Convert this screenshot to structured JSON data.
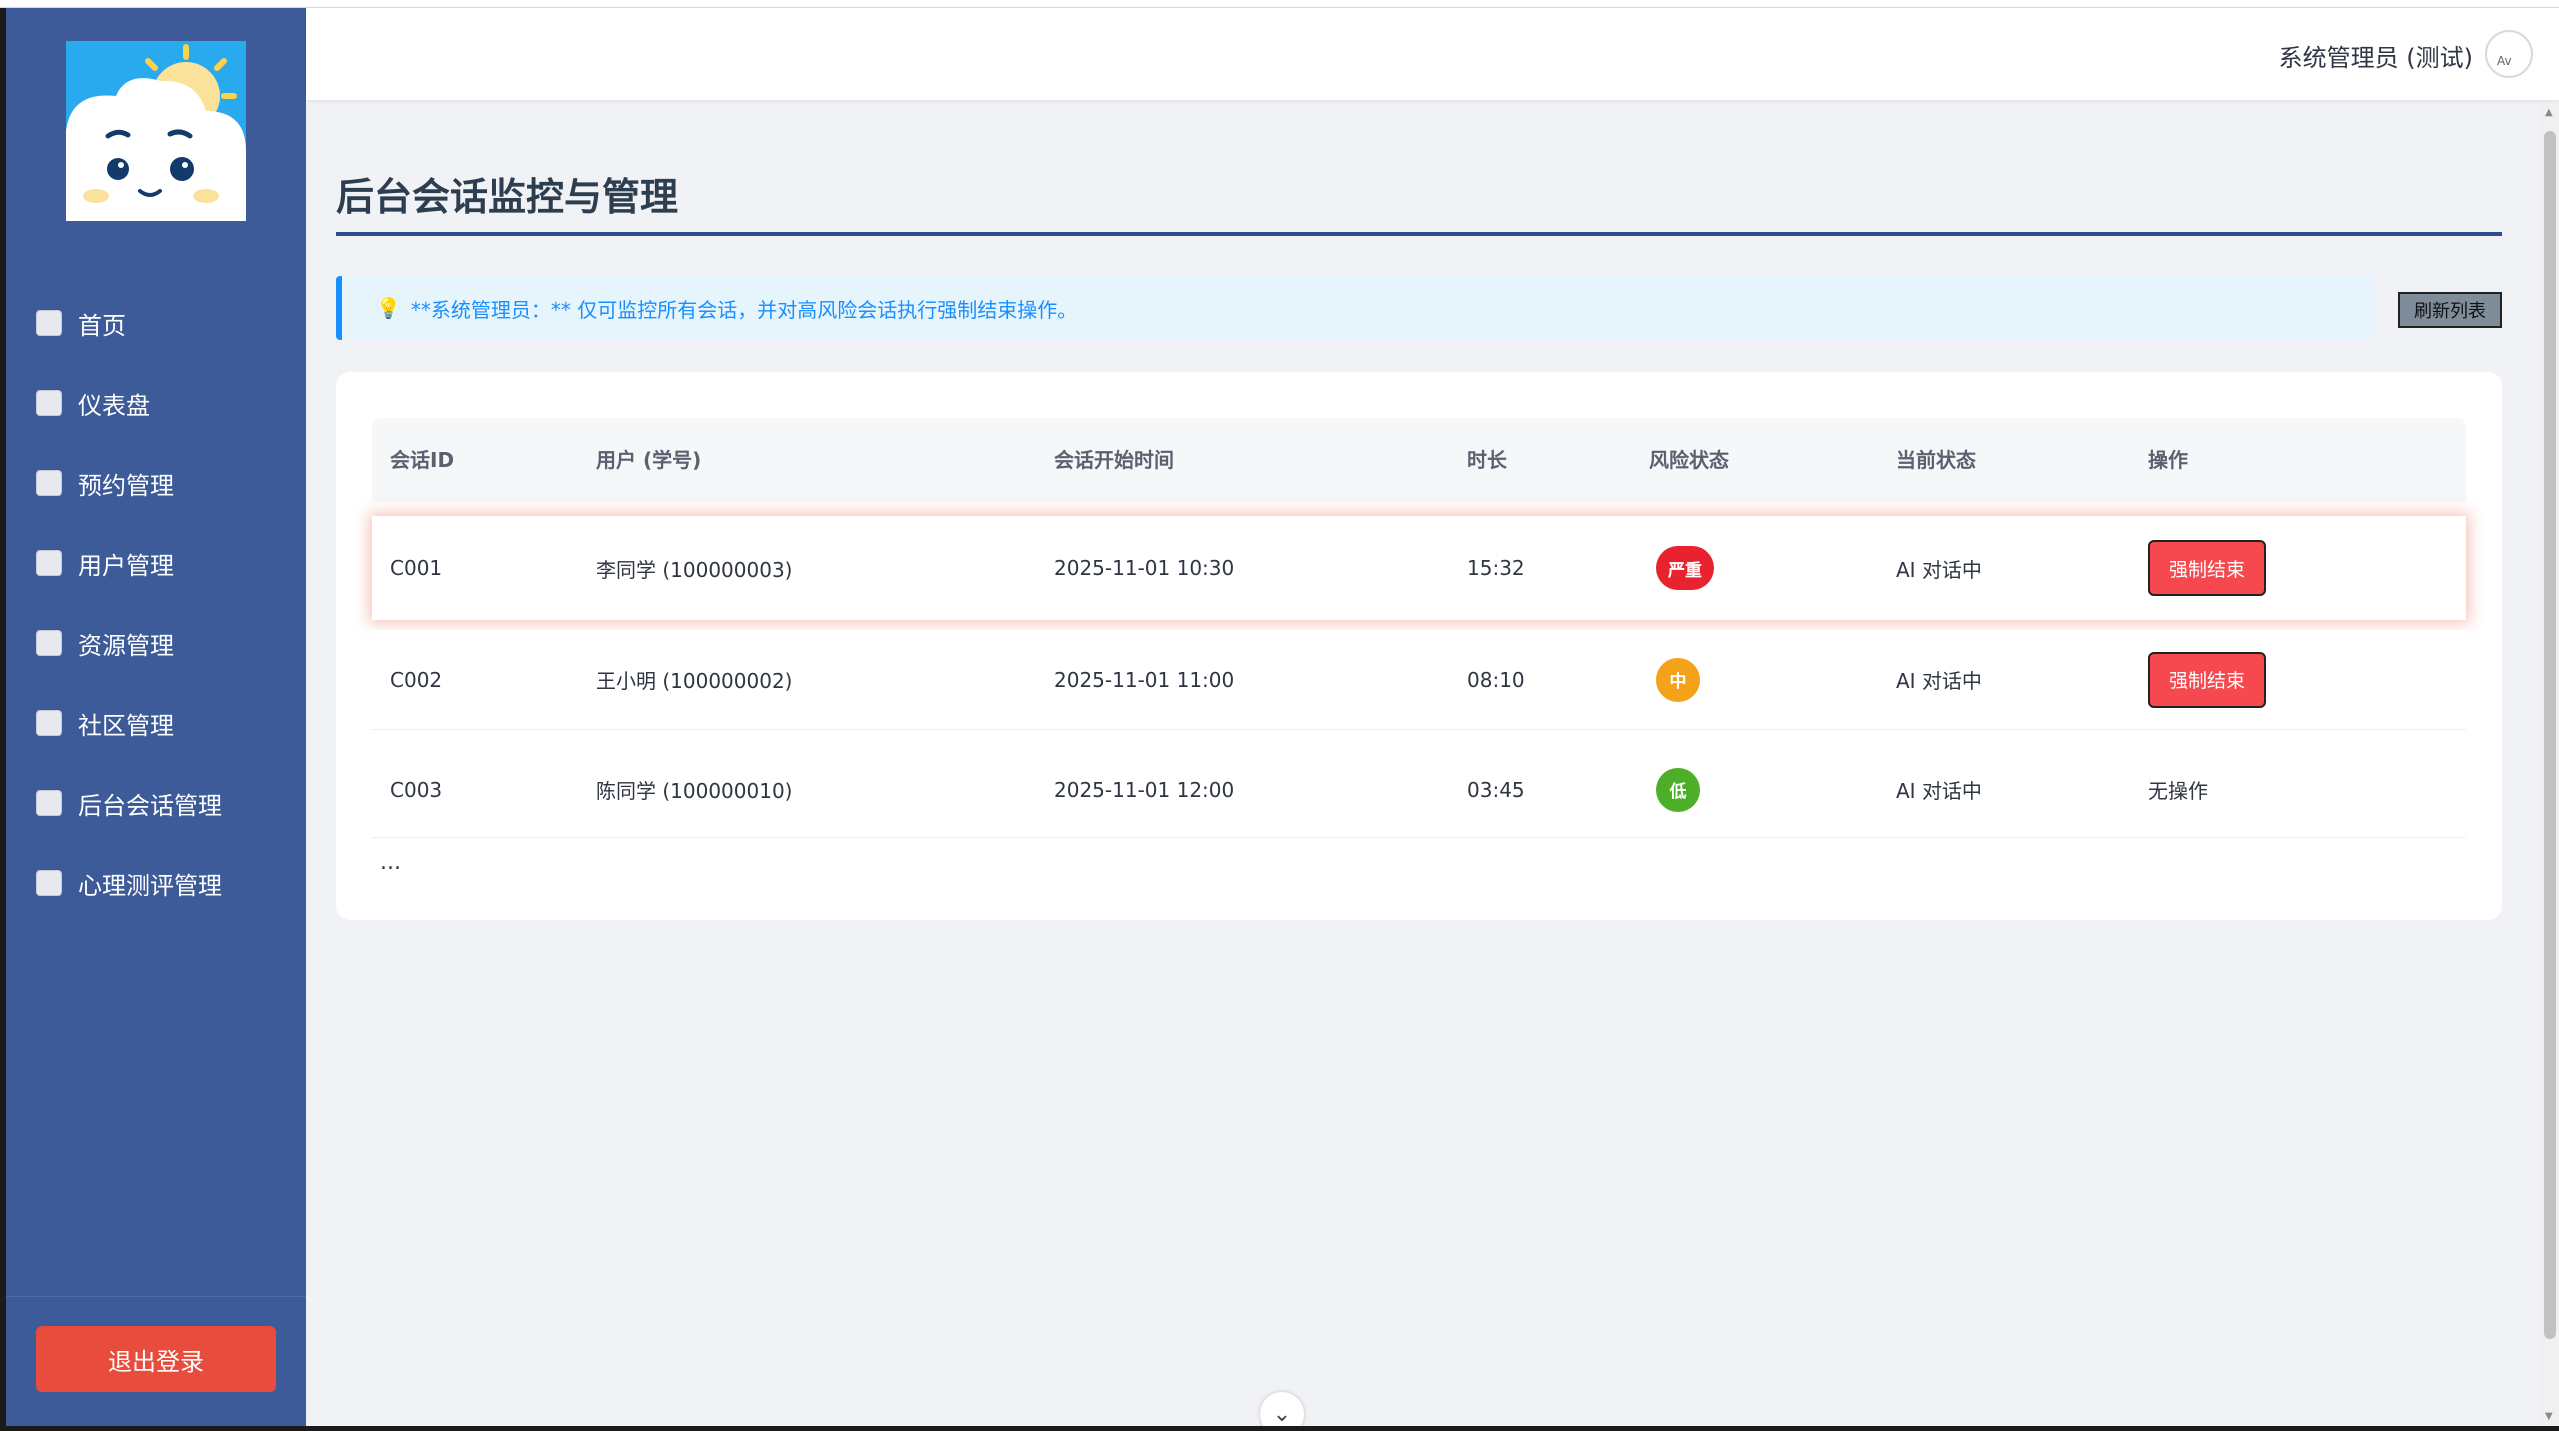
{
  "header": {
    "user_name": "系统管理员 (测试)",
    "avatar_alt": "Av"
  },
  "sidebar": {
    "items": [
      {
        "label": "首页"
      },
      {
        "label": "仪表盘"
      },
      {
        "label": "预约管理"
      },
      {
        "label": "用户管理"
      },
      {
        "label": "资源管理"
      },
      {
        "label": "社区管理"
      },
      {
        "label": "后台会话管理"
      },
      {
        "label": "心理测评管理"
      }
    ],
    "logout_label": "退出登录"
  },
  "main": {
    "title": "后台会话监控与管理",
    "notice_icon": "lightbulb-icon",
    "notice_text": "**系统管理员：** 仅可监控所有会话，并对高风险会话执行强制结束操作。",
    "refresh_label": "刷新列表",
    "table": {
      "headers": [
        "会话ID",
        "用户 (学号)",
        "会话开始时间",
        "时长",
        "风险状态",
        "当前状态",
        "操作"
      ],
      "rows": [
        {
          "id": "C001",
          "user": "李同学 (100000003)",
          "start": "2025-11-01 10:30",
          "duration": "15:32",
          "risk": "严重",
          "risk_color": "#e8232f",
          "status": "AI 对话中",
          "action": "强制结束"
        },
        {
          "id": "C002",
          "user": "王小明 (100000002)",
          "start": "2025-11-01 11:00",
          "duration": "08:10",
          "risk": "中",
          "risk_color": "#f5a21b",
          "status": "AI 对话中",
          "action": "强制结束"
        },
        {
          "id": "C003",
          "user": "陈同学 (100000010)",
          "start": "2025-11-01 12:00",
          "duration": "03:45",
          "risk": "低",
          "risk_color": "#4caf27",
          "status": "AI 对话中",
          "action": "无操作"
        }
      ],
      "more": "..."
    }
  },
  "colors": {
    "sidebar_bg": "#3d5a99",
    "danger": "#f5494f",
    "notice_text": "#1890ff"
  }
}
